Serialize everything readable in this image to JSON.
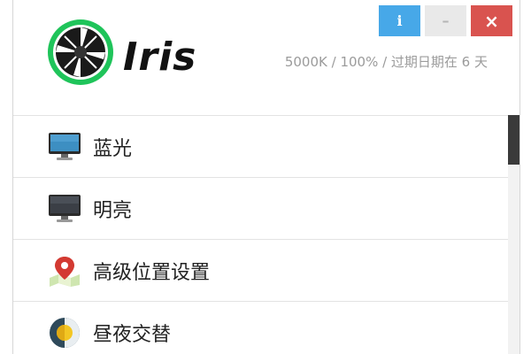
{
  "app": {
    "name": "Iris",
    "status": "5000K / 100% / 过期日期在 6 天"
  },
  "window_controls": {
    "info_label": "i",
    "minimize_label": "–",
    "close_label": "×"
  },
  "menu": {
    "items": [
      {
        "label": "蓝光",
        "icon": "monitor-blue-icon"
      },
      {
        "label": "明亮",
        "icon": "monitor-dark-icon"
      },
      {
        "label": "高级位置设置",
        "icon": "map-pin-icon"
      },
      {
        "label": "昼夜交替",
        "icon": "day-night-icon"
      }
    ]
  },
  "colors": {
    "info": "#47a8e8",
    "minimize": "#e9e9e9",
    "close": "#d9534f",
    "logo_green": "#1fc45a",
    "status_text": "#9b9b9b"
  }
}
